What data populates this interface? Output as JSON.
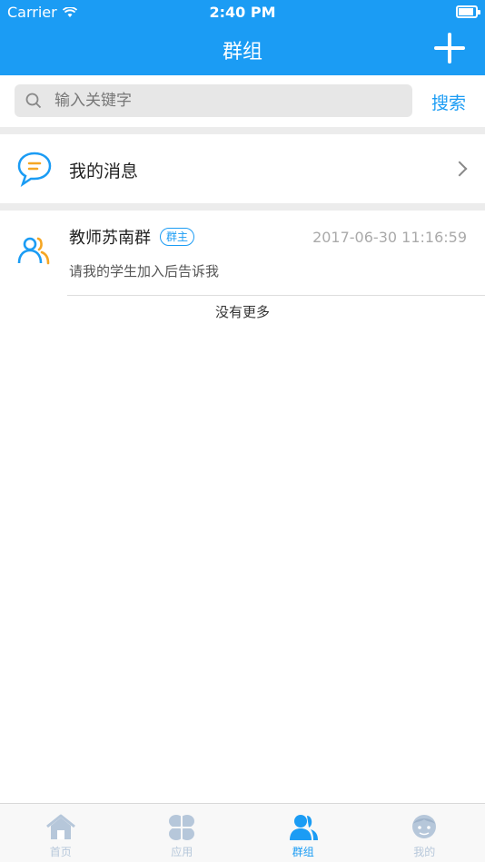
{
  "status_bar": {
    "carrier": "Carrier",
    "time": "2:40 PM"
  },
  "nav": {
    "title": "群组",
    "add_icon": "plus-icon"
  },
  "search": {
    "placeholder": "输入关键字",
    "value": "",
    "button_label": "搜索",
    "icon": "search-icon"
  },
  "my_messages": {
    "label": "我的消息",
    "icon": "chat-bubble-icon"
  },
  "groups": [
    {
      "name": "教师苏南群",
      "badge": "群主",
      "timestamp": "2017-06-30 11:16:59",
      "preview": "请我的学生加入后告诉我",
      "icon": "group-icon"
    }
  ],
  "list_footer": "没有更多",
  "tabbar": {
    "items": [
      {
        "label": "首页",
        "icon": "home-icon",
        "active": false
      },
      {
        "label": "应用",
        "icon": "apps-icon",
        "active": false
      },
      {
        "label": "群组",
        "icon": "group-icon",
        "active": true
      },
      {
        "label": "我的",
        "icon": "profile-icon",
        "active": false
      }
    ]
  },
  "colors": {
    "accent": "#1b9cf4",
    "tab_inactive": "#b6c7da",
    "divider": "#ececec"
  }
}
